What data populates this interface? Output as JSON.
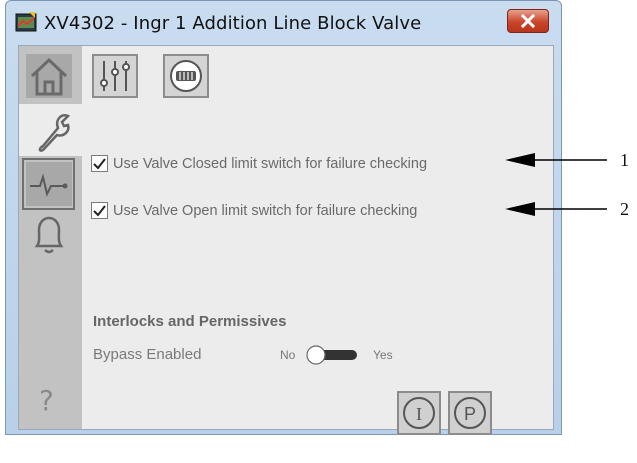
{
  "window": {
    "title": "XV4302 - Ingr 1 Addition Line Block Valve"
  },
  "nav": {
    "items": [
      "home-icon",
      "wrench-icon",
      "trend-icon",
      "bell-icon"
    ],
    "help_glyph": "?"
  },
  "toolbar": {
    "buttons": [
      "sliders-icon",
      "limit-switch-icon"
    ]
  },
  "checks": [
    {
      "label": "Use Valve Closed limit switch for failure checking",
      "checked": true
    },
    {
      "label": "Use Valve Open limit switch for failure checking",
      "checked": true
    }
  ],
  "interlocks": {
    "section_title": "Interlocks and Permissives",
    "bypass_label": "Bypass Enabled",
    "toggle_off": "No",
    "toggle_on": "Yes"
  },
  "bottom_buttons": [
    "I",
    "P"
  ],
  "callouts": [
    "1",
    "2"
  ],
  "colors": {
    "close": "#c9452b",
    "nav_rail": "#c2c2c2",
    "content_bg": "#ececec"
  }
}
